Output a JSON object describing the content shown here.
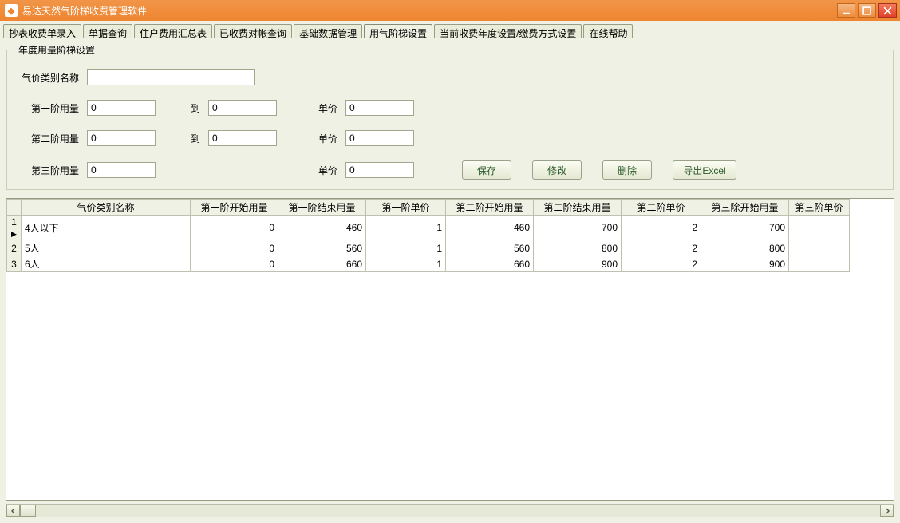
{
  "window": {
    "title": "易达天然气阶梯收费管理软件"
  },
  "tabs": [
    {
      "label": "抄表收费单录入"
    },
    {
      "label": "单据查询"
    },
    {
      "label": "住户费用汇总表"
    },
    {
      "label": "已收费对帐查询"
    },
    {
      "label": "基础数据管理"
    },
    {
      "label": "用气阶梯设置",
      "active": true
    },
    {
      "label": "当前收费年度设置/缴费方式设置"
    },
    {
      "label": "在线帮助"
    }
  ],
  "group": {
    "legend": "年度用量阶梯设置",
    "name_label": "气价类别名称",
    "tier1_label": "第一阶用量",
    "tier2_label": "第二阶用量",
    "tier3_label": "第三阶用量",
    "to_label": "到",
    "price_label": "单价",
    "name_value": "",
    "tier1_from": "0",
    "tier1_to": "0",
    "tier1_price": "0",
    "tier2_from": "0",
    "tier2_to": "0",
    "tier2_price": "0",
    "tier3_from": "0",
    "tier3_price": "0"
  },
  "buttons": {
    "save": "保存",
    "edit": "修改",
    "delete": "删除",
    "export": "导出Excel"
  },
  "table": {
    "headers": [
      "气价类别名称",
      "第一阶开始用量",
      "第一阶结束用量",
      "第一阶单价",
      "第二阶开始用量",
      "第二阶结束用量",
      "第二阶单价",
      "第三除开始用量",
      "第三阶单价"
    ],
    "rows": [
      {
        "idx": "1",
        "current": true,
        "cells": [
          "4人以下",
          "0",
          "460",
          "1",
          "460",
          "700",
          "2",
          "700",
          ""
        ]
      },
      {
        "idx": "2",
        "current": false,
        "cells": [
          "5人",
          "0",
          "560",
          "1",
          "560",
          "800",
          "2",
          "800",
          ""
        ]
      },
      {
        "idx": "3",
        "current": false,
        "cells": [
          "6人",
          "0",
          "660",
          "1",
          "660",
          "900",
          "2",
          "900",
          ""
        ]
      }
    ]
  }
}
